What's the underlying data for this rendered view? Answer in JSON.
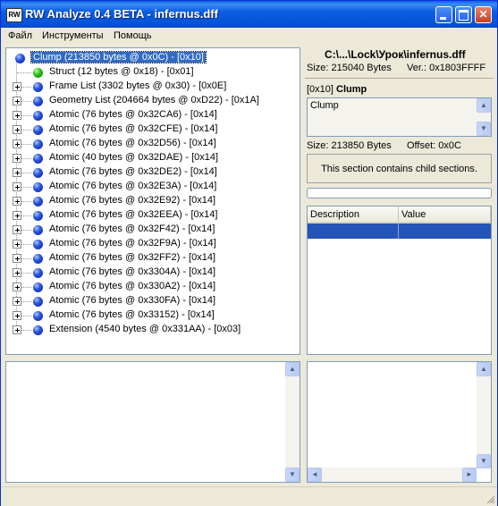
{
  "window": {
    "title": "RW Analyze 0.4 BETA - infernus.dff",
    "app_icon_text": "RW",
    "close_glyph": "✕"
  },
  "menu": [
    "Файл",
    "Инструменты",
    "Помощь"
  ],
  "tree": [
    {
      "label": "Clump  (213850 bytes @ 0x0C) - [0x10]",
      "icon": "blue",
      "indent": 0,
      "expander": false,
      "selected": true
    },
    {
      "label": "Struct  (12 bytes @ 0x18) - [0x01]",
      "icon": "green",
      "indent": 1,
      "expander": false
    },
    {
      "label": "Frame List  (3302 bytes @ 0x30) - [0x0E]",
      "icon": "blue",
      "indent": 1,
      "expander": true
    },
    {
      "label": "Geometry List  (204664 bytes @ 0xD22) - [0x1A]",
      "icon": "blue",
      "indent": 1,
      "expander": true
    },
    {
      "label": "Atomic  (76 bytes @ 0x32CA6) - [0x14]",
      "icon": "blue",
      "indent": 1,
      "expander": true
    },
    {
      "label": "Atomic  (76 bytes @ 0x32CFE) - [0x14]",
      "icon": "blue",
      "indent": 1,
      "expander": true
    },
    {
      "label": "Atomic  (76 bytes @ 0x32D56) - [0x14]",
      "icon": "blue",
      "indent": 1,
      "expander": true
    },
    {
      "label": "Atomic  (40 bytes @ 0x32DAE) - [0x14]",
      "icon": "blue",
      "indent": 1,
      "expander": true
    },
    {
      "label": "Atomic  (76 bytes @ 0x32DE2) - [0x14]",
      "icon": "blue",
      "indent": 1,
      "expander": true
    },
    {
      "label": "Atomic  (76 bytes @ 0x32E3A) - [0x14]",
      "icon": "blue",
      "indent": 1,
      "expander": true
    },
    {
      "label": "Atomic  (76 bytes @ 0x32E92) - [0x14]",
      "icon": "blue",
      "indent": 1,
      "expander": true
    },
    {
      "label": "Atomic  (76 bytes @ 0x32EEA) - [0x14]",
      "icon": "blue",
      "indent": 1,
      "expander": true
    },
    {
      "label": "Atomic  (76 bytes @ 0x32F42) - [0x14]",
      "icon": "blue",
      "indent": 1,
      "expander": true
    },
    {
      "label": "Atomic  (76 bytes @ 0x32F9A) - [0x14]",
      "icon": "blue",
      "indent": 1,
      "expander": true
    },
    {
      "label": "Atomic  (76 bytes @ 0x32FF2) - [0x14]",
      "icon": "blue",
      "indent": 1,
      "expander": true
    },
    {
      "label": "Atomic  (76 bytes @ 0x3304A) - [0x14]",
      "icon": "blue",
      "indent": 1,
      "expander": true
    },
    {
      "label": "Atomic  (76 bytes @ 0x330A2) - [0x14]",
      "icon": "blue",
      "indent": 1,
      "expander": true
    },
    {
      "label": "Atomic  (76 bytes @ 0x330FA) - [0x14]",
      "icon": "blue",
      "indent": 1,
      "expander": true
    },
    {
      "label": "Atomic  (76 bytes @ 0x33152) - [0x14]",
      "icon": "blue",
      "indent": 1,
      "expander": true
    },
    {
      "label": "Extension  (4540 bytes @ 0x331AA) - [0x03]",
      "icon": "blue",
      "indent": 1,
      "expander": true
    }
  ],
  "file_info": {
    "path": "C:\\...\\Lock\\Урок\\infernus.dff",
    "size": "Size: 215040 Bytes",
    "version": "Ver.: 0x1803FFFF"
  },
  "section": {
    "id": "[0x10]",
    "name": "Clump",
    "description": "Clump",
    "size": "Size: 213850 Bytes",
    "offset": "Offset: 0x0C",
    "status": "This section contains child sections."
  },
  "grid": {
    "columns": [
      "Description",
      "Value"
    ],
    "selected_row": [
      "",
      ""
    ]
  },
  "colors": {
    "title_bar": "#0653d6",
    "selection": "#316ac5",
    "grid_selection": "#2454b5",
    "window_bg": "#ece9d8"
  }
}
